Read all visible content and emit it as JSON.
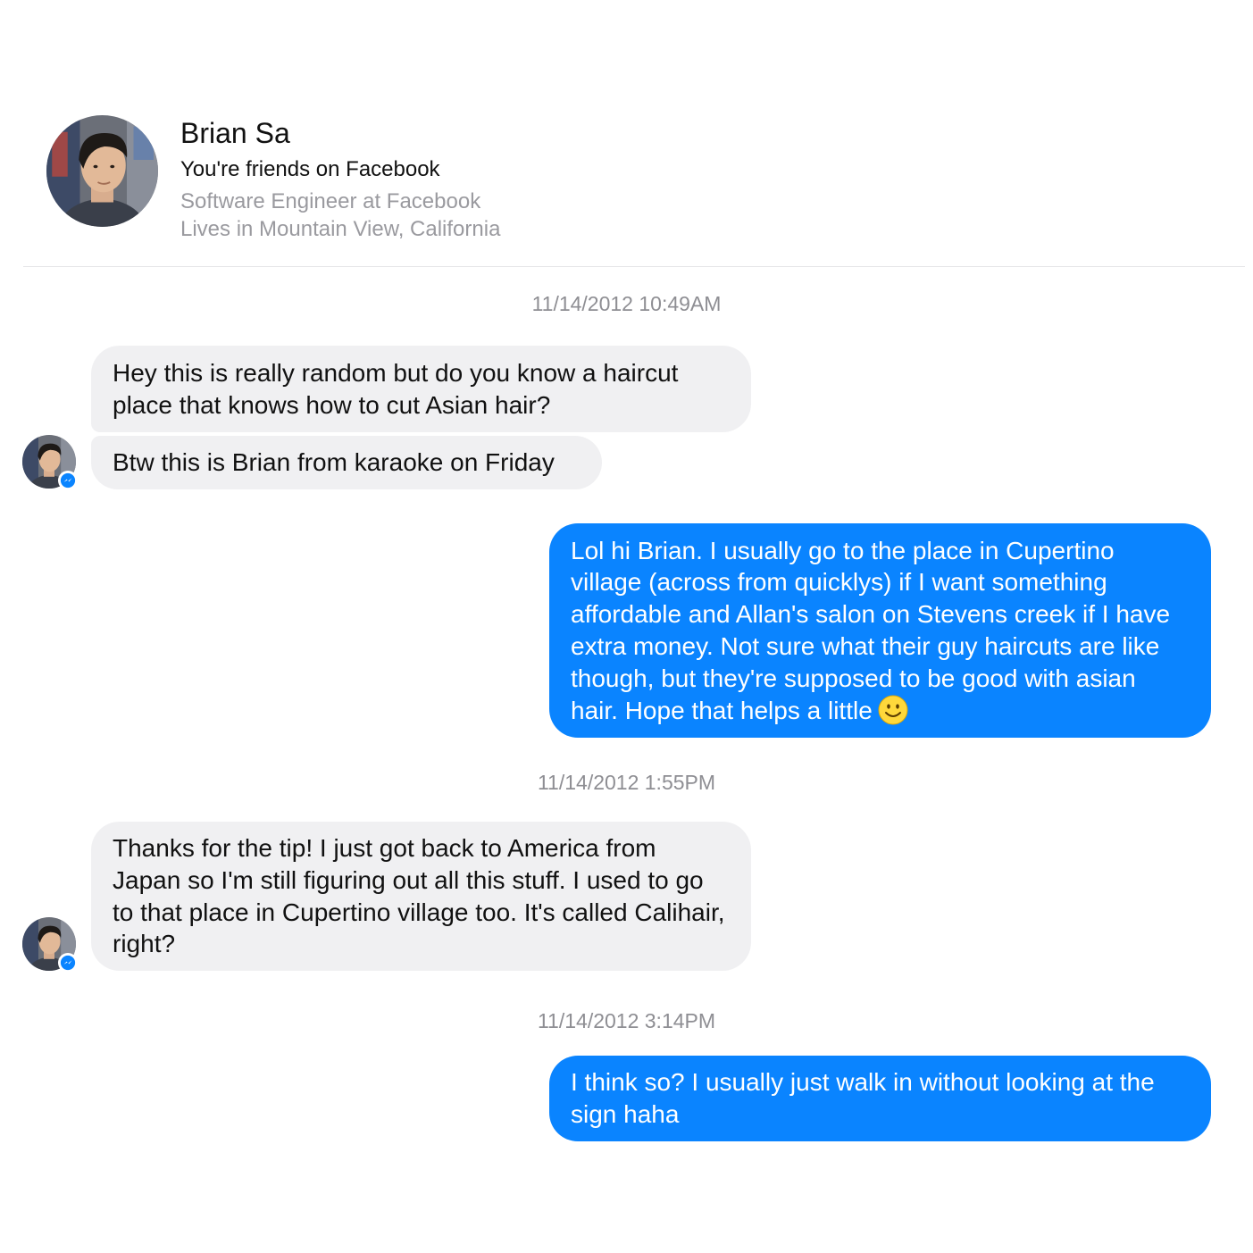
{
  "profile": {
    "name": "Brian Sa",
    "relationship": "You're friends on Facebook",
    "work": "Software Engineer at Facebook",
    "location": "Lives in Mountain View, California",
    "avatar_icon": "profile-photo",
    "messenger_badge_color": "#0a84ff"
  },
  "colors": {
    "incoming_bubble": "#f0f0f2",
    "outgoing_bubble": "#0a84ff",
    "timestamp_text": "#8e8e93",
    "secondary_text": "#9a9a9f"
  },
  "conversation": [
    {
      "type": "timestamp",
      "text": "11/14/2012 10:49AM"
    },
    {
      "type": "message",
      "direction": "incoming",
      "text": "Hey this is really random but do you know a haircut place that knows how to cut Asian hair?"
    },
    {
      "type": "message",
      "direction": "incoming",
      "text": "Btw this is Brian from karaoke on Friday"
    },
    {
      "type": "message",
      "direction": "outgoing",
      "text": "Lol hi Brian. I usually go to the place in Cupertino village (across from quicklys) if I want something affordable and Allan's salon on Stevens creek if I have extra money. Not sure what their guy haircuts are like though, but they're supposed to be good with asian hair. Hope that helps a little",
      "emoji": "smiley-emoji"
    },
    {
      "type": "timestamp",
      "text": "11/14/2012 1:55PM"
    },
    {
      "type": "message",
      "direction": "incoming",
      "text": "Thanks for the tip! I just got back to America from Japan so I'm still figuring out all this stuff. I used to go to that place in Cupertino village too. It's called Calihair, right?"
    },
    {
      "type": "timestamp",
      "text": "11/14/2012 3:14PM"
    },
    {
      "type": "message",
      "direction": "outgoing",
      "text": "I think so? I usually just walk in without looking at the sign haha"
    }
  ]
}
